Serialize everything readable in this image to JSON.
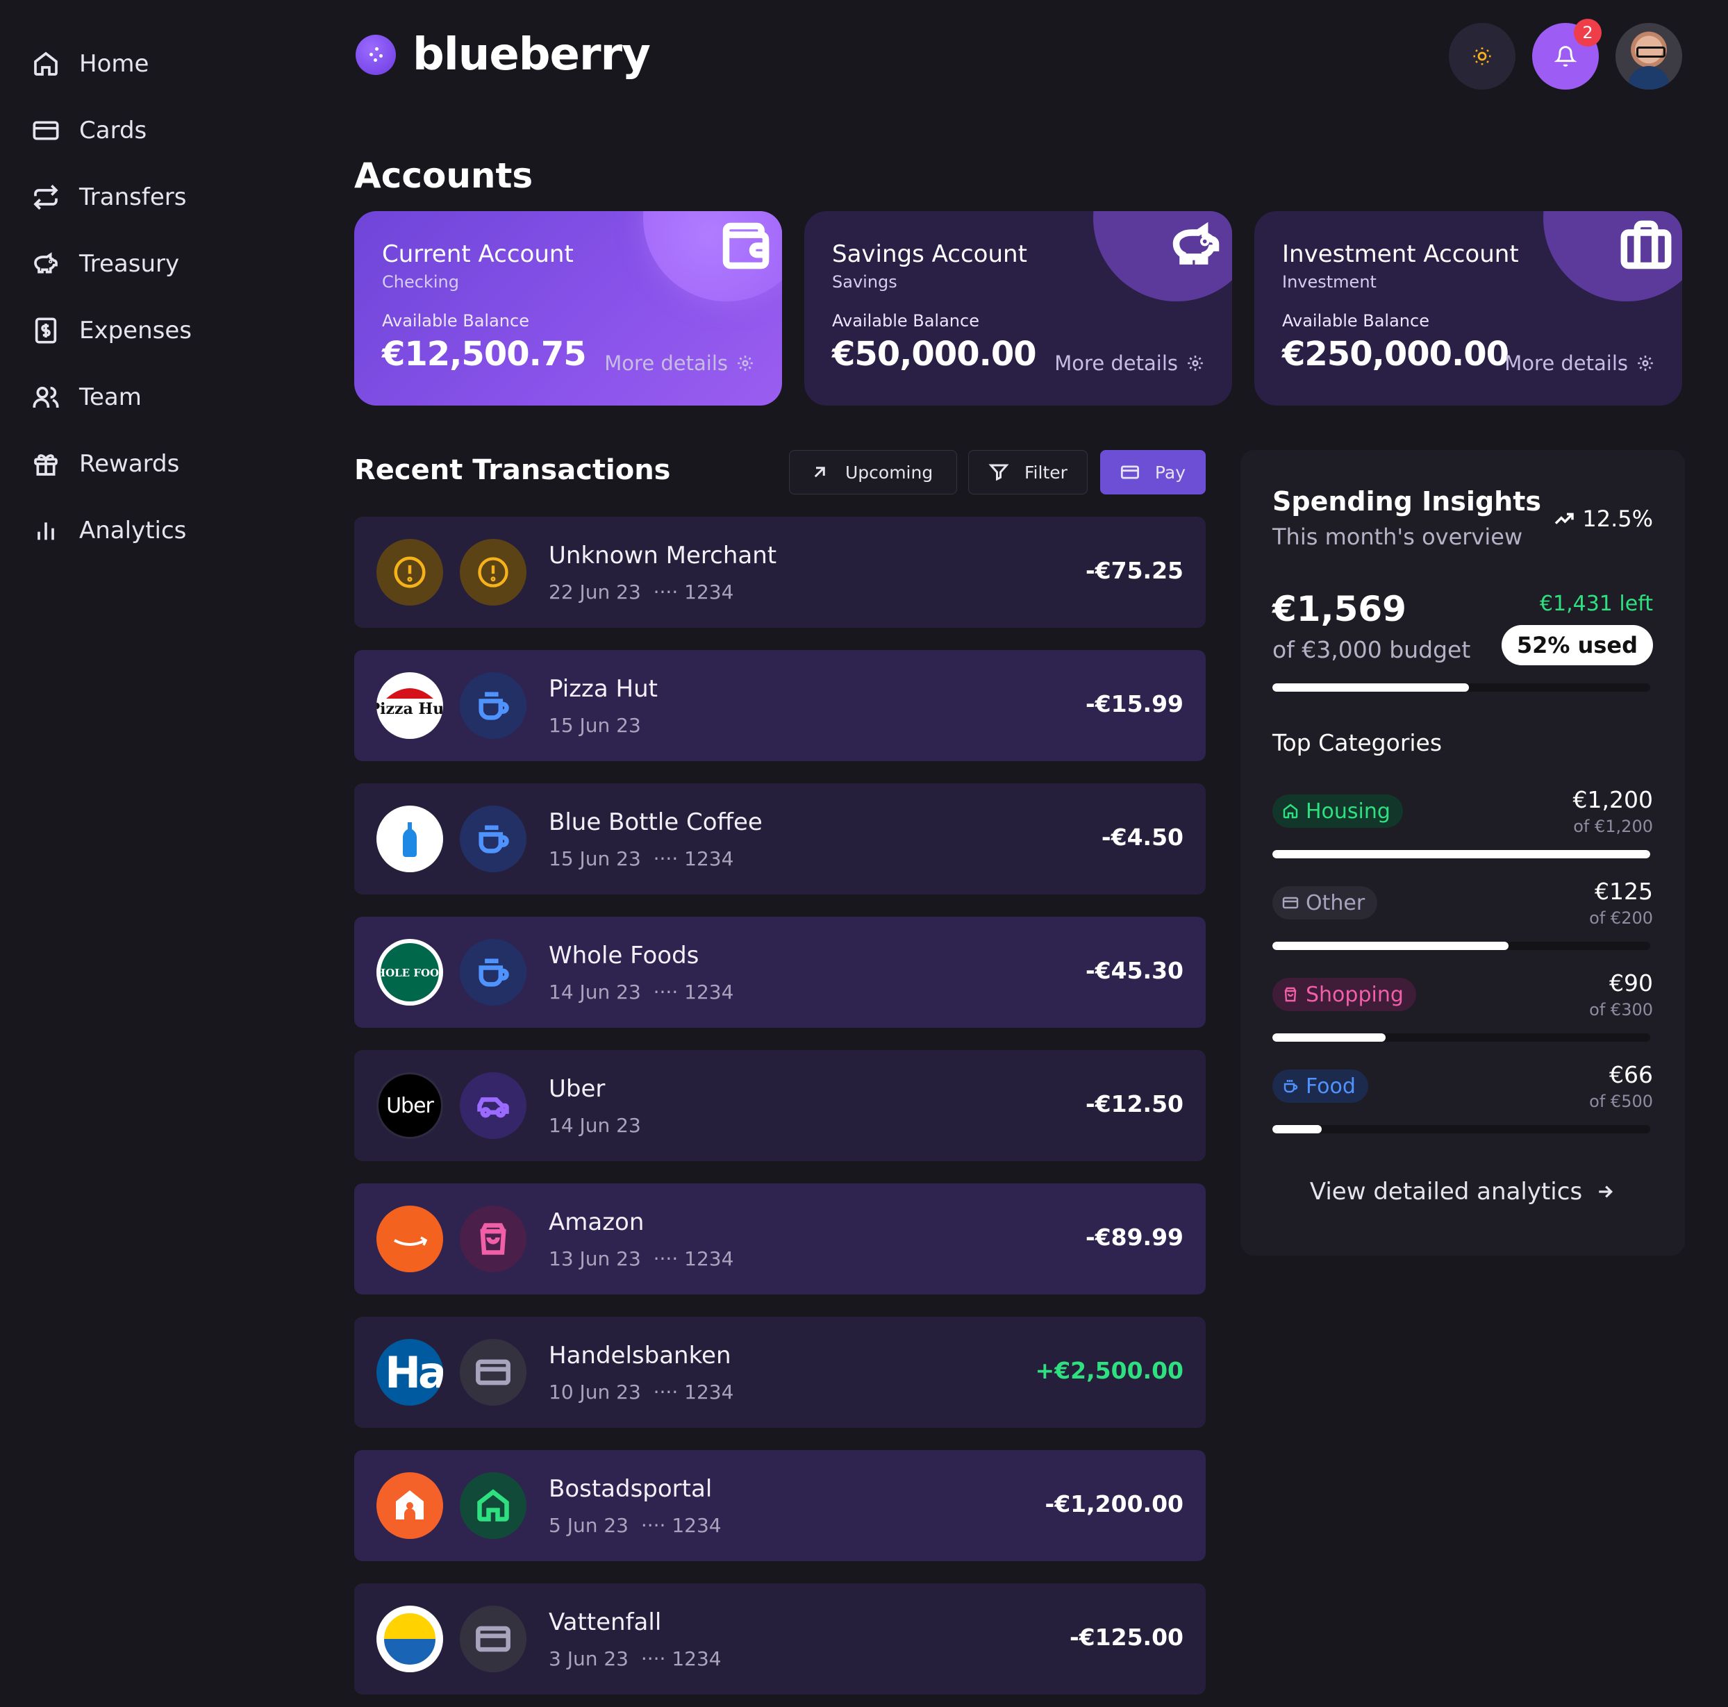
{
  "sidebar": {
    "items": [
      {
        "label": "Home",
        "icon": "home-icon"
      },
      {
        "label": "Cards",
        "icon": "card-icon"
      },
      {
        "label": "Transfers",
        "icon": "transfer-icon"
      },
      {
        "label": "Treasury",
        "icon": "piggy-bank-icon"
      },
      {
        "label": "Expenses",
        "icon": "receipt-icon"
      },
      {
        "label": "Team",
        "icon": "users-icon"
      },
      {
        "label": "Rewards",
        "icon": "gift-icon"
      },
      {
        "label": "Analytics",
        "icon": "bar-chart-icon"
      }
    ]
  },
  "header": {
    "brand": "blueberry",
    "notification_count": "2",
    "accent": "#9d5cf3"
  },
  "accounts": {
    "title": "Accounts",
    "items": [
      {
        "name": "Current Account",
        "type": "Checking",
        "available_label": "Available Balance",
        "balance": "€12,500.75",
        "more": "More details",
        "icon": "wallet-icon"
      },
      {
        "name": "Savings Account",
        "type": "Savings",
        "available_label": "Available Balance",
        "balance": "€50,000.00",
        "more": "More details",
        "icon": "piggy-bank-icon"
      },
      {
        "name": "Investment Account",
        "type": "Investment",
        "available_label": "Available Balance",
        "balance": "€250,000.00",
        "more": "More details",
        "icon": "briefcase-icon"
      }
    ]
  },
  "transactions": {
    "title": "Recent Transactions",
    "buttons": {
      "upcoming": "Upcoming",
      "filter": "Filter",
      "pay": "Pay"
    },
    "items": [
      {
        "merchant": "Unknown Merchant",
        "date": "22 Jun 23",
        "card": "···· 1234",
        "amount": "-€75.25",
        "category_icon": "alert-icon"
      },
      {
        "merchant": "Pizza Hut",
        "date": "15 Jun 23",
        "card": "",
        "amount": "-€15.99",
        "category_icon": "coffee-cup-icon",
        "logo_text": "Pizza Hut"
      },
      {
        "merchant": "Blue Bottle Coffee",
        "date": "15 Jun 23",
        "card": "···· 1234",
        "amount": "-€4.50",
        "category_icon": "coffee-cup-icon"
      },
      {
        "merchant": "Whole Foods",
        "date": "14 Jun 23",
        "card": "···· 1234",
        "amount": "-€45.30",
        "category_icon": "coffee-cup-icon",
        "logo_text": "WHOLE FOODS"
      },
      {
        "merchant": "Uber",
        "date": "14 Jun 23",
        "card": "",
        "amount": "-€12.50",
        "category_icon": "car-icon",
        "logo_text": "Uber"
      },
      {
        "merchant": "Amazon",
        "date": "13 Jun 23",
        "card": "···· 1234",
        "amount": "-€89.99",
        "category_icon": "shopping-bag-icon"
      },
      {
        "merchant": "Handelsbanken",
        "date": "10 Jun 23",
        "card": "···· 1234",
        "amount": "+€2,500.00",
        "category_icon": "card-icon",
        "logo_text": "Ha"
      },
      {
        "merchant": "Bostadsportal",
        "date": "5 Jun 23",
        "card": "···· 1234",
        "amount": "-€1,200.00",
        "category_icon": "home-icon"
      },
      {
        "merchant": "Vattenfall",
        "date": "3 Jun 23",
        "card": "···· 1234",
        "amount": "-€125.00",
        "category_icon": "card-icon"
      }
    ]
  },
  "insights": {
    "title": "Spending Insights",
    "subtitle": "This month's overview",
    "trend": "12.5%",
    "spent": "€1,569",
    "budget": "of €3,000 budget",
    "left": "€1,431 left",
    "used": "52% used",
    "used_fraction": 0.52,
    "top_categories_title": "Top Categories",
    "categories": [
      {
        "name": "Housing",
        "amount": "€1,200",
        "of": "of €1,200",
        "fraction": 1.0,
        "color": "#2ee07f",
        "icon": "home-icon"
      },
      {
        "name": "Other",
        "amount": "€125",
        "of": "of €200",
        "fraction": 0.625,
        "color": "#a9a4bd",
        "icon": "card-icon"
      },
      {
        "name": "Shopping",
        "amount": "€90",
        "of": "of €300",
        "fraction": 0.3,
        "color": "#f05fa8",
        "icon": "shopping-bag-icon"
      },
      {
        "name": "Food",
        "amount": "€66",
        "of": "of €500",
        "fraction": 0.13,
        "color": "#4f93ff",
        "icon": "coffee-cup-icon"
      }
    ],
    "view_link": "View detailed analytics"
  }
}
